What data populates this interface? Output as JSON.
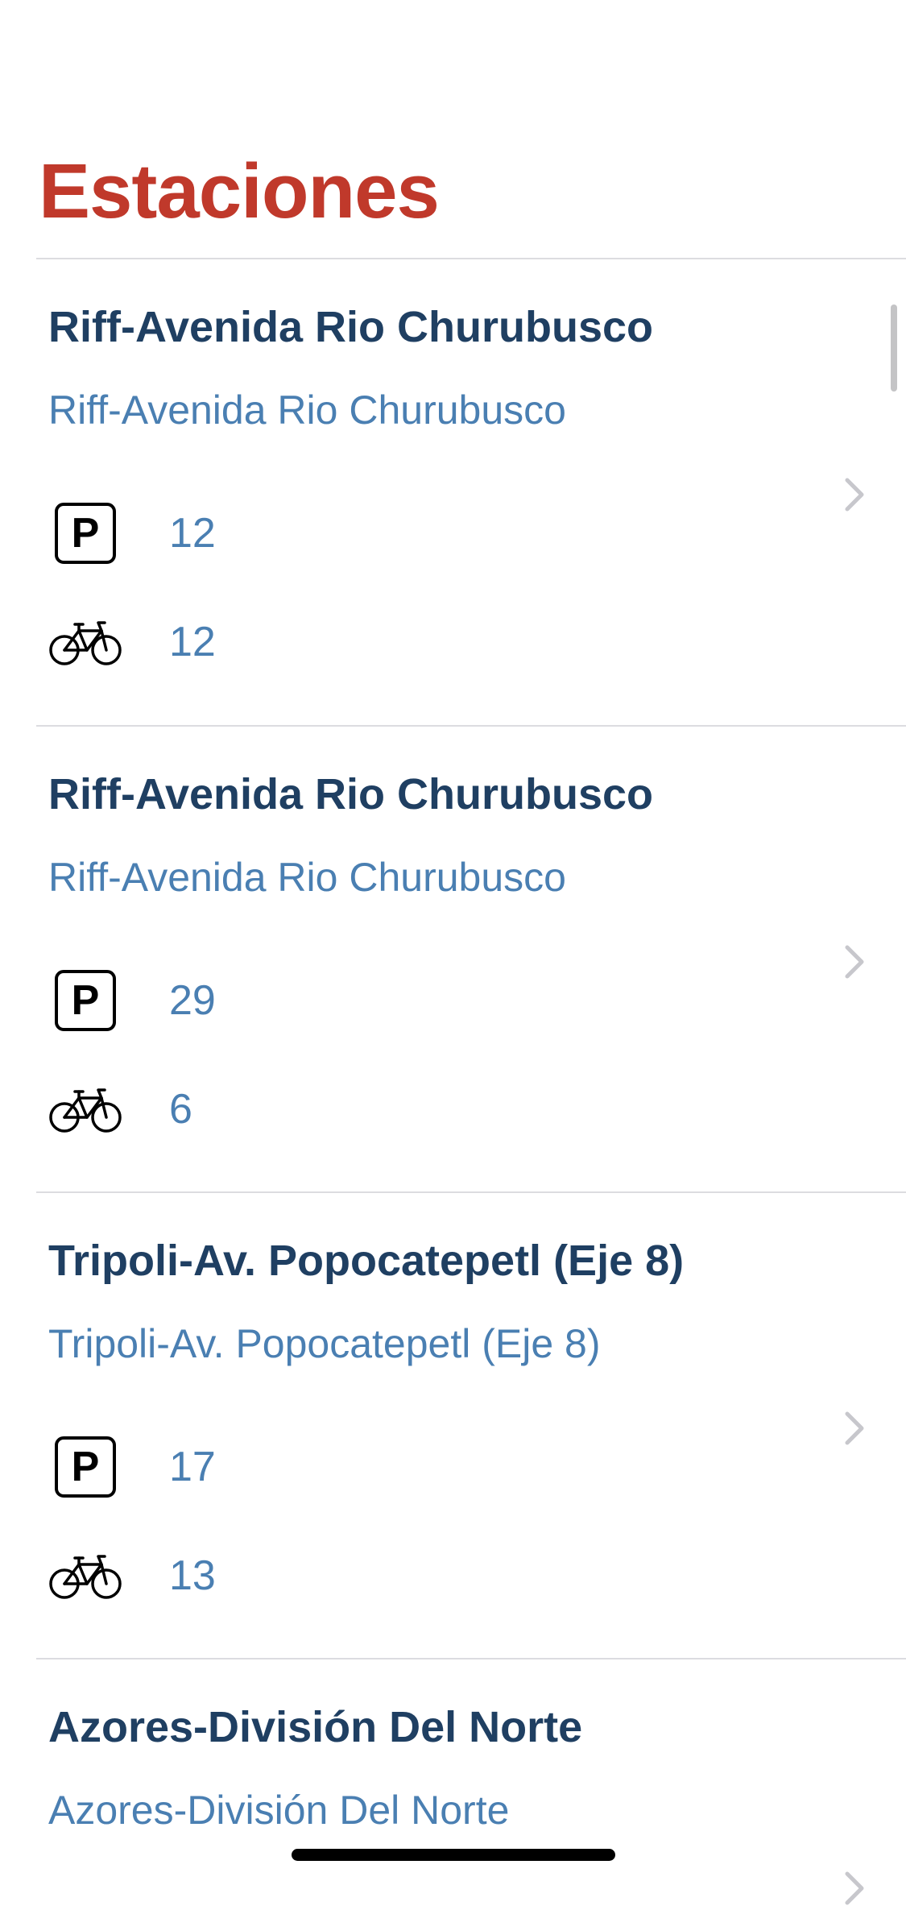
{
  "header": {
    "title": "Estaciones"
  },
  "stations": [
    {
      "name": "Riff-Avenida Rio Churubusco",
      "address": "Riff-Avenida Rio Churubusco",
      "parking_icon": "parking-icon",
      "parking": "12",
      "bikes_icon": "bicycle-icon",
      "bikes": "12"
    },
    {
      "name": "Riff-Avenida Rio Churubusco",
      "address": "Riff-Avenida Rio Churubusco",
      "parking_icon": "parking-icon",
      "parking": "29",
      "bikes_icon": "bicycle-icon",
      "bikes": "6"
    },
    {
      "name": "Tripoli-Av. Popocatepetl (Eje 8)",
      "address": "Tripoli-Av. Popocatepetl (Eje 8)",
      "parking_icon": "parking-icon",
      "parking": "17",
      "bikes_icon": "bicycle-icon",
      "bikes": "13"
    },
    {
      "name": "Azores-División Del Norte",
      "address": "Azores-División Del Norte"
    }
  ],
  "colors": {
    "title": "#c0392b",
    "station_name": "#1f3f62",
    "secondary": "#4a7fb2",
    "divider": "#dcdce0",
    "chevron": "#c7c7cc"
  }
}
